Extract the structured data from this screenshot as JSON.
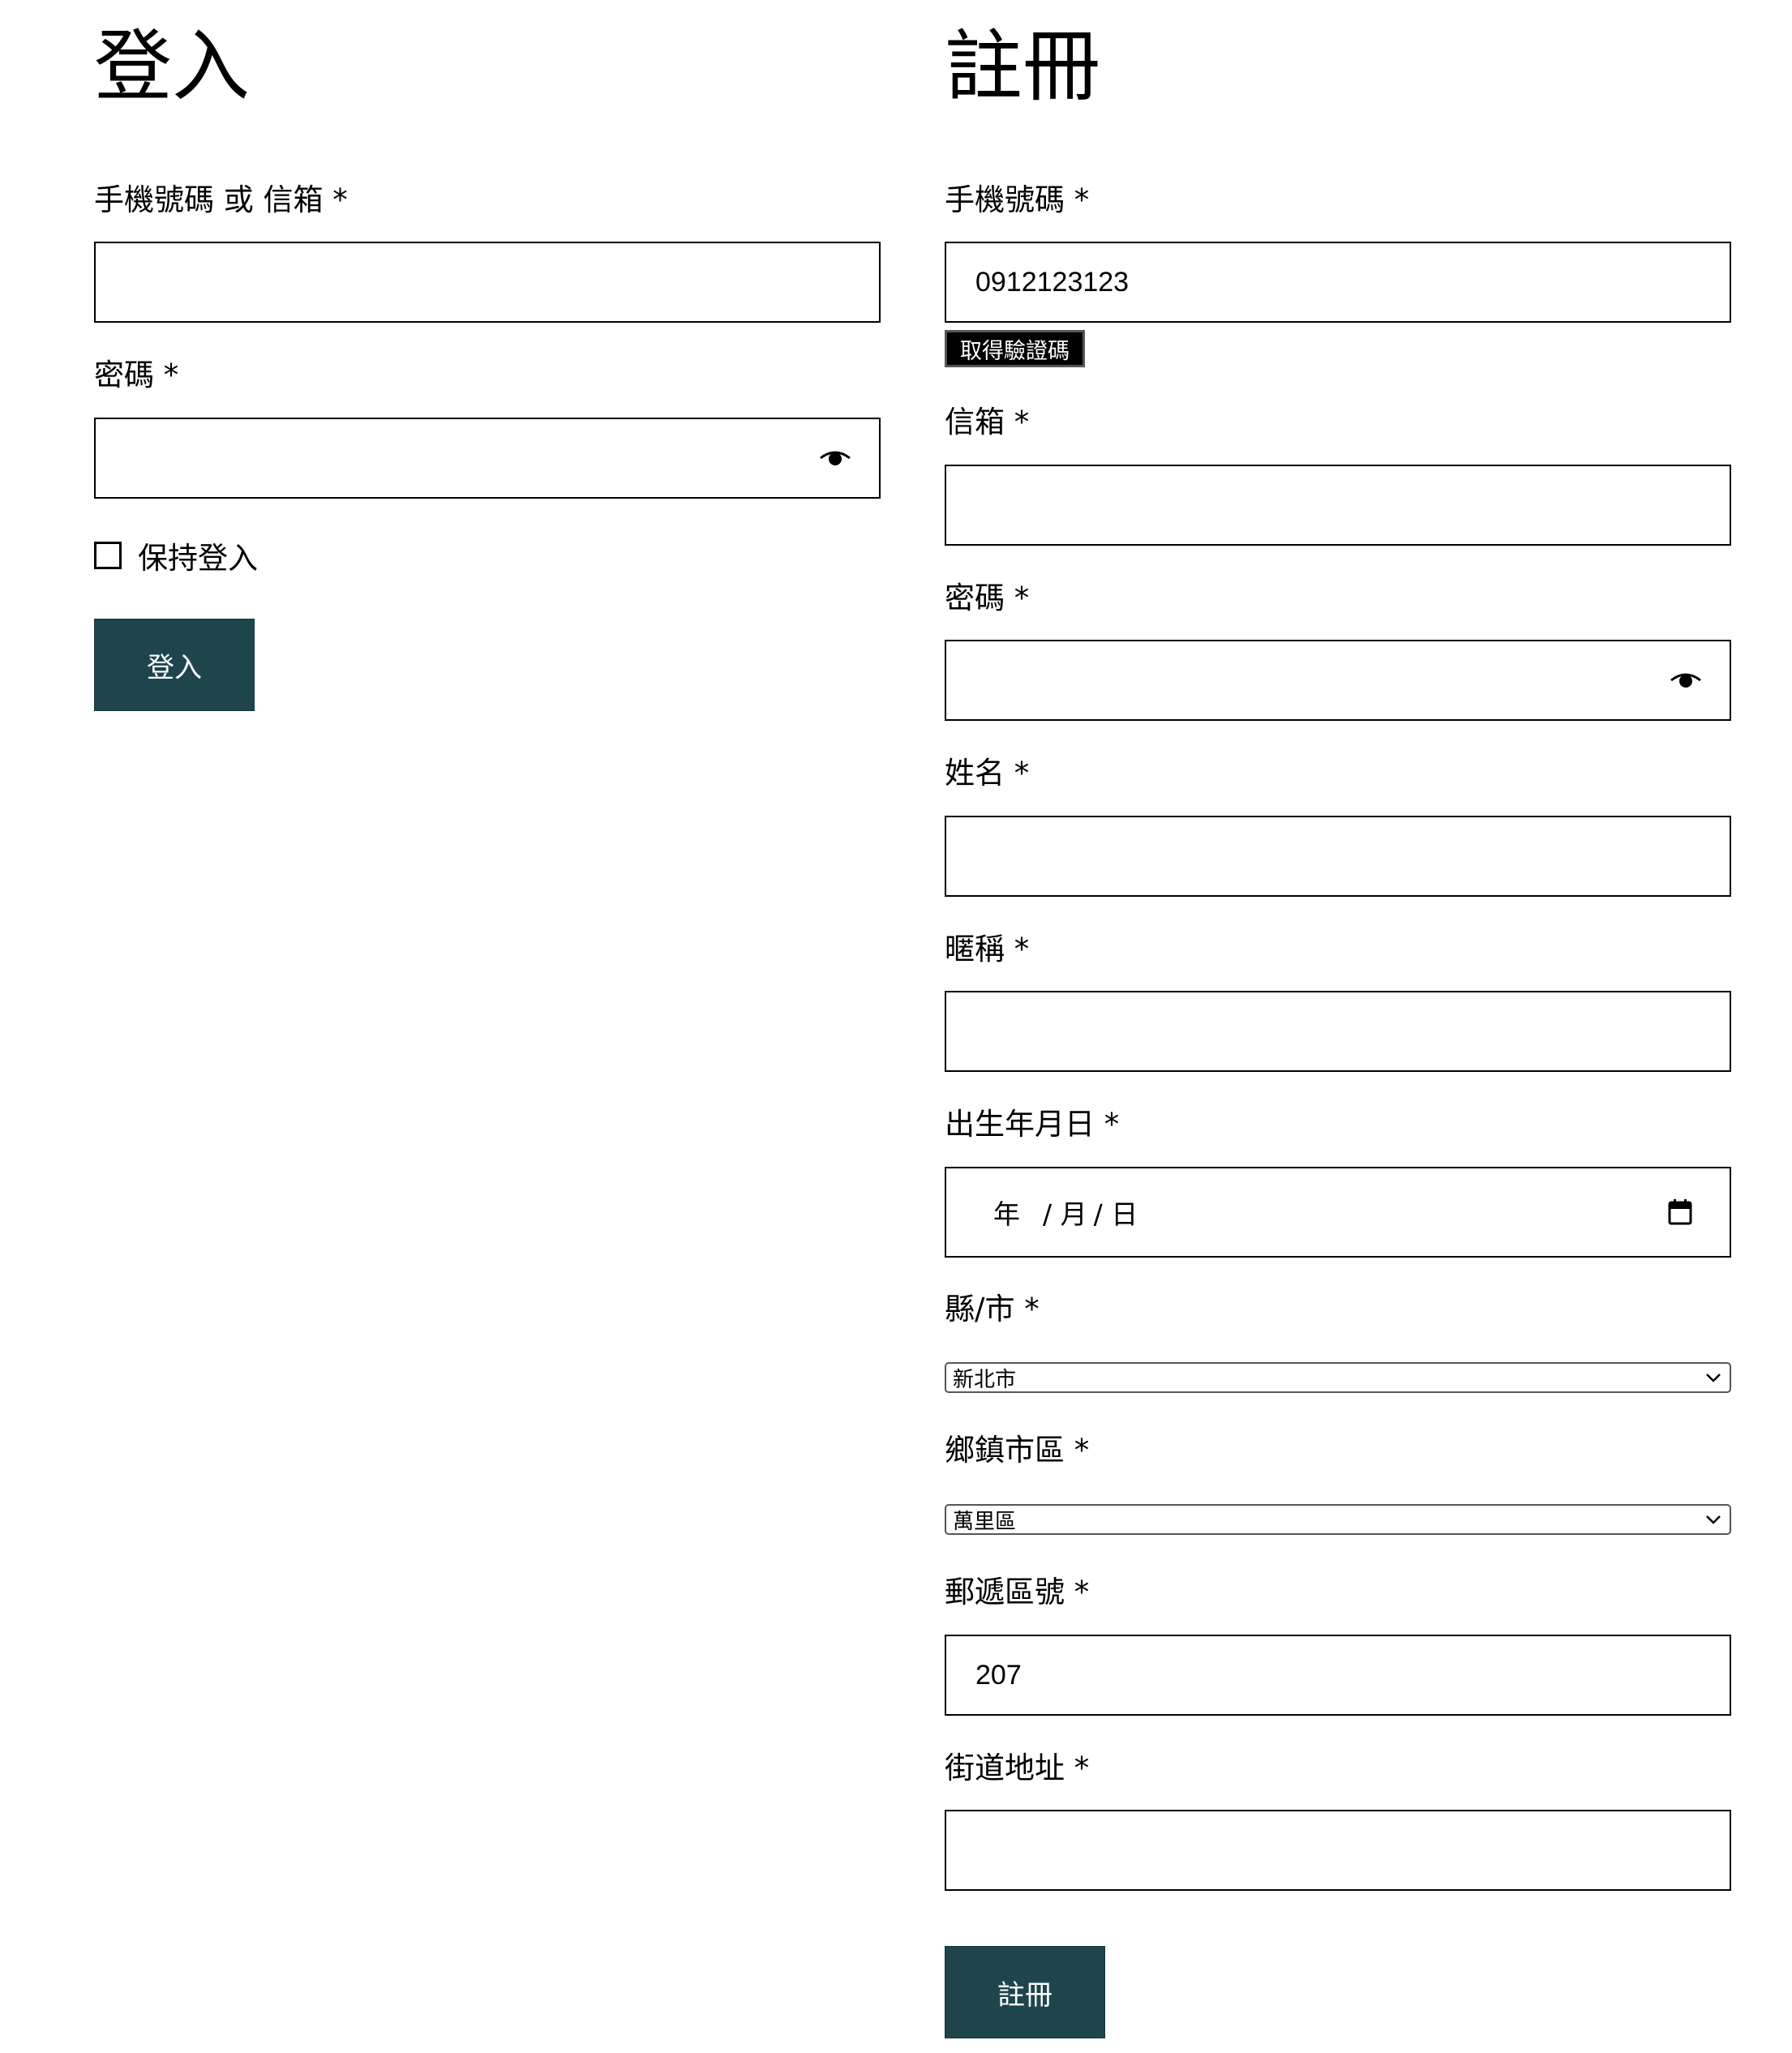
{
  "login": {
    "title": "登入",
    "account_label": "手機號碼 或 信箱 *",
    "account_value": "",
    "password_label": "密碼 *",
    "password_value": "",
    "remember_label": "保持登入",
    "remember_checked": false,
    "submit_label": "登入"
  },
  "register": {
    "title": "註冊",
    "phone_label": "手機號碼 *",
    "phone_value": "0912123123",
    "get_code_label": "取得驗證碼",
    "email_label": "信箱 *",
    "email_value": "",
    "password_label": "密碼 *",
    "password_value": "",
    "name_label": "姓名 *",
    "name_value": "",
    "nickname_label": "暱稱 *",
    "nickname_value": "",
    "birthday_label": "出生年月日 *",
    "birthday_year": "年",
    "birthday_month": "/ 月",
    "birthday_day": "/ 日",
    "city_label": "縣/市 *",
    "city_value": "新北市",
    "district_label": "鄉鎮市區 *",
    "district_value": "萬里區",
    "zip_label": "郵遞區號 *",
    "zip_value": "207",
    "street_label": "街道地址 *",
    "street_value": "",
    "submit_label": "註冊"
  },
  "colors": {
    "button_bg": "#1e454c",
    "text": "#000000",
    "background": "#ffffff"
  },
  "icons": {
    "password_toggle": "eye-icon",
    "date_picker": "calendar-icon",
    "select_arrow": "chevron-down-icon"
  }
}
